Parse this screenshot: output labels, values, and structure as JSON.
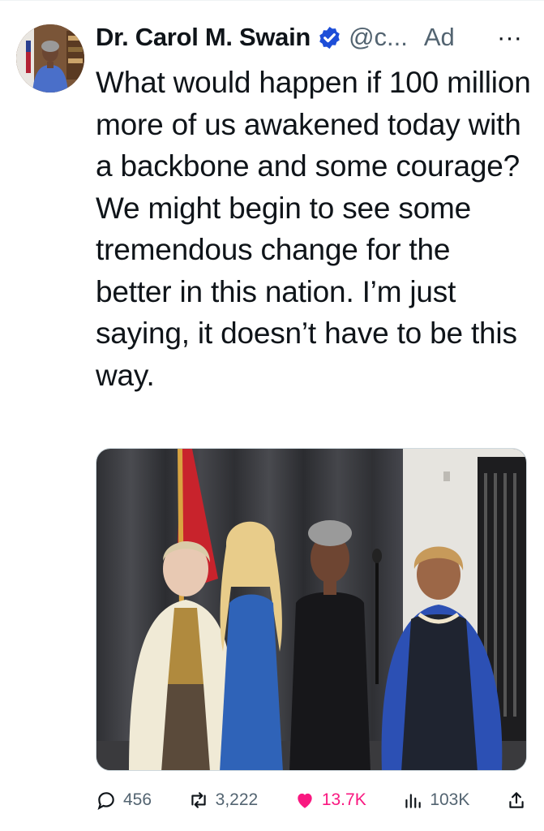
{
  "author": {
    "display_name": "Dr. Carol M. Swain",
    "handle": "@c...",
    "verified": true,
    "ad_label": "Ad",
    "more_glyph": "···"
  },
  "tweet": {
    "text": "What would happen if 100 million more of us awakened today with a backbone and some courage? We might begin to see some tremendous change for the better in this nation. I’m just saying, it doesn’t have to be this way."
  },
  "media": {
    "type": "photo"
  },
  "actions": {
    "replies": "456",
    "reposts": "3,222",
    "likes": "13.7K",
    "views": "103K"
  },
  "colors": {
    "like_accent": "#f91880",
    "verified": "#1d4ed8",
    "muted_text": "#536471"
  },
  "icons": [
    "reply-icon",
    "repost-icon",
    "heart-icon",
    "views-icon",
    "share-icon",
    "verified-icon",
    "more-icon"
  ]
}
